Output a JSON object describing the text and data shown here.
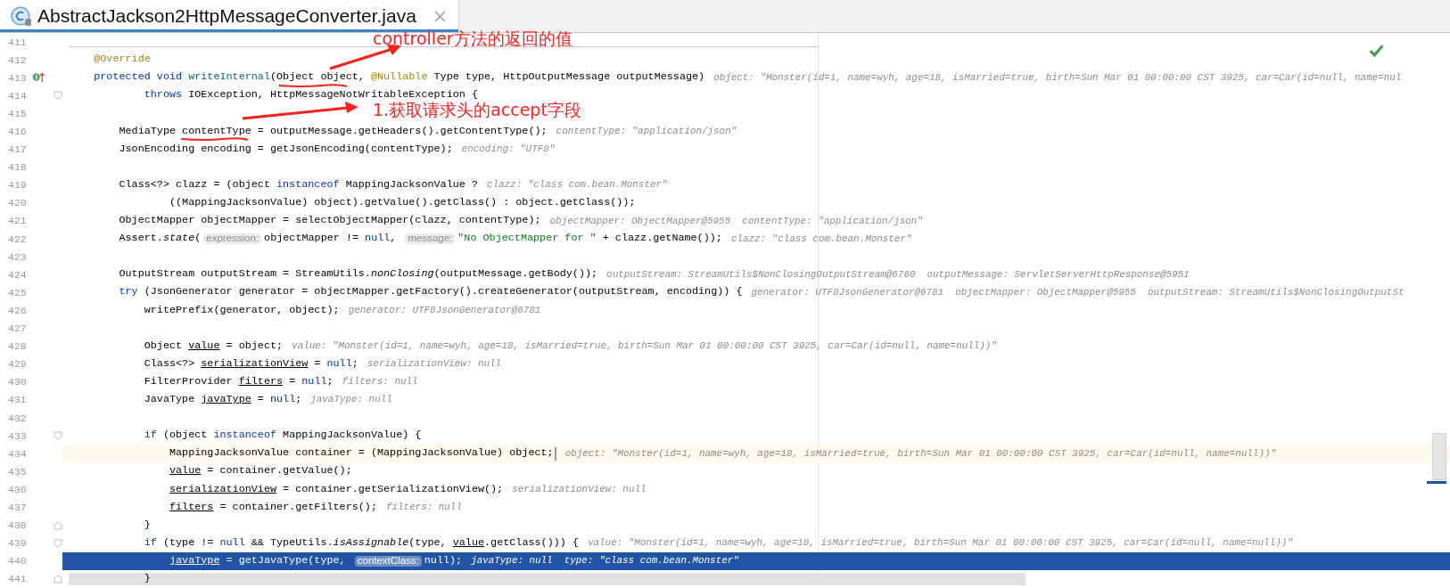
{
  "tab": {
    "title": "AbstractJackson2HttpMessageConverter.java",
    "selected": true
  },
  "lines": [
    {
      "number": "411"
    },
    {
      "number": "412",
      "code": [
        {
          "text": "    @Override",
          "kind": "annotation"
        }
      ]
    },
    {
      "number": "413",
      "implements": true,
      "code": [
        {
          "text": "    protected void ",
          "kind": "keyword"
        },
        {
          "text": "writeInternal",
          "kind": "method"
        },
        {
          "text": "(Object object, ",
          "kind": "plain"
        },
        {
          "text": "@Nullable",
          "kind": "annotation"
        },
        {
          "text": " Type type, HttpOutputMessage outputMessage)",
          "kind": "plain"
        }
      ],
      "hint": "object: \"Monster(id=1, name=wyh, age=18, isMarried=true, birth=Sun Mar 01 00:00:00 CST 3925, car=Car(id=null, name=nul"
    },
    {
      "number": "414",
      "fold_start": true,
      "code": [
        {
          "text": "            throws",
          "kind": "keyword"
        },
        {
          "text": " IOException, HttpMessageNotWritableException {",
          "kind": "plain"
        }
      ]
    },
    {
      "number": "415"
    },
    {
      "number": "416",
      "code": [
        {
          "text": "        MediaType contentType = outputMessage.getHeaders().getContentType();",
          "kind": "plain"
        }
      ],
      "hint": "contentType: \"application/json\""
    },
    {
      "number": "417",
      "code": [
        {
          "text": "        JsonEncoding encoding = getJsonEncoding(contentType);",
          "kind": "plain"
        }
      ],
      "hint": "encoding: \"UTF8\""
    },
    {
      "number": "418"
    },
    {
      "number": "419",
      "code": [
        {
          "text": "        Class<?> clazz = (object ",
          "kind": "plain"
        },
        {
          "text": "instanceof",
          "kind": "keyword"
        },
        {
          "text": " MappingJacksonValue ?",
          "kind": "plain"
        }
      ],
      "hint": "clazz: \"class com.bean.Monster\""
    },
    {
      "number": "420",
      "code": [
        {
          "text": "                ((MappingJacksonValue) object).getValue().getClass() : object.getClass());",
          "kind": "plain"
        }
      ]
    },
    {
      "number": "421",
      "code": [
        {
          "text": "        ObjectMapper objectMapper = selectObjectMapper(clazz, contentType);",
          "kind": "plain"
        }
      ],
      "hint": "objectMapper: ObjectMapper@5955  contentType: \"application/json\""
    },
    {
      "number": "422",
      "code": [
        {
          "text": "        Assert.",
          "kind": "plain"
        },
        {
          "text": "state",
          "kind": "static"
        },
        {
          "text": "(",
          "kind": "plain"
        },
        {
          "text": "expression:",
          "kind": "param_hint"
        },
        {
          "text": "objectMapper != ",
          "kind": "plain"
        },
        {
          "text": "null",
          "kind": "keyword"
        },
        {
          "text": ", ",
          "kind": "plain"
        },
        {
          "text": "message:",
          "kind": "param_hint"
        },
        {
          "text": "\"No ObjectMapper for \"",
          "kind": "string"
        },
        {
          "text": " + clazz.getName());",
          "kind": "plain"
        }
      ],
      "hint": "clazz: \"class com.bean.Monster\""
    },
    {
      "number": "423"
    },
    {
      "number": "424",
      "code": [
        {
          "text": "        OutputStream outputStream = StreamUtils.",
          "kind": "plain"
        },
        {
          "text": "nonClosing",
          "kind": "static"
        },
        {
          "text": "(outputMessage.getBody());",
          "kind": "plain"
        }
      ],
      "hint": "outputStream: StreamUtils$NonClosingOutputStream@6760  outputMessage: ServletServerHttpResponse@5951"
    },
    {
      "number": "425",
      "code": [
        {
          "text": "        try",
          "kind": "keyword"
        },
        {
          "text": " (JsonGenerator generator = objectMapper.getFactory().createGenerator(outputStream, encoding)) {",
          "kind": "plain"
        }
      ],
      "hint": "generator: UTF8JsonGenerator@6781  objectMapper: ObjectMapper@5955  outputStream: StreamUtils$NonClosingOutputSt"
    },
    {
      "number": "426",
      "code": [
        {
          "text": "            writePrefix(generator, object);",
          "kind": "plain"
        }
      ],
      "hint": "generator: UTF8JsonGenerator@6781"
    },
    {
      "number": "427"
    },
    {
      "number": "428",
      "code": [
        {
          "text": "            Object ",
          "kind": "plain"
        },
        {
          "text": "value",
          "kind": "reassigned"
        },
        {
          "text": " = object;",
          "kind": "plain"
        }
      ],
      "hint": "value: \"Monster(id=1, name=wyh, age=18, isMarried=true, birth=Sun Mar 01 00:00:00 CST 3925, car=Car(id=null, name=null))\""
    },
    {
      "number": "429",
      "code": [
        {
          "text": "            Class<?> ",
          "kind": "plain"
        },
        {
          "text": "serializationView",
          "kind": "reassigned"
        },
        {
          "text": " = ",
          "kind": "plain"
        },
        {
          "text": "null",
          "kind": "keyword"
        },
        {
          "text": ";",
          "kind": "plain"
        }
      ],
      "hint": "serializationView: null"
    },
    {
      "number": "430",
      "code": [
        {
          "text": "            FilterProvider ",
          "kind": "plain"
        },
        {
          "text": "filters",
          "kind": "reassigned"
        },
        {
          "text": " = ",
          "kind": "plain"
        },
        {
          "text": "null",
          "kind": "keyword"
        },
        {
          "text": ";",
          "kind": "plain"
        }
      ],
      "hint": "filters: null"
    },
    {
      "number": "431",
      "code": [
        {
          "text": "            JavaType ",
          "kind": "plain"
        },
        {
          "text": "javaType",
          "kind": "reassigned"
        },
        {
          "text": " = ",
          "kind": "plain"
        },
        {
          "text": "null",
          "kind": "keyword"
        },
        {
          "text": ";",
          "kind": "plain"
        }
      ],
      "hint": "javaType: null"
    },
    {
      "number": "432"
    },
    {
      "number": "433",
      "fold_start": true,
      "code": [
        {
          "text": "            if",
          "kind": "keyword"
        },
        {
          "text": " (object ",
          "kind": "plain"
        },
        {
          "text": "instanceof",
          "kind": "keyword"
        },
        {
          "text": " MappingJacksonValue) {",
          "kind": "plain"
        }
      ]
    },
    {
      "number": "434",
      "caret_line": true,
      "code": [
        {
          "text": "                MappingJacksonValue container = (MappingJacksonValue) object;",
          "kind": "plain"
        }
      ],
      "hint": "object: \"Monster(id=1, name=wyh, age=18, isMarried=true, birth=Sun Mar 01 00:00:00 CST 3925, car=Car(id=null, name=null))\""
    },
    {
      "number": "435",
      "code": [
        {
          "text": "                value",
          "kind": "reassigned"
        },
        {
          "text": " = container.getValue();",
          "kind": "plain"
        }
      ]
    },
    {
      "number": "436",
      "code": [
        {
          "text": "                serializationView",
          "kind": "reassigned"
        },
        {
          "text": " = container.getSerializationView();",
          "kind": "plain"
        }
      ],
      "hint": "serializationView: null"
    },
    {
      "number": "437",
      "code": [
        {
          "text": "                filters",
          "kind": "reassigned"
        },
        {
          "text": " = container.getFilters();",
          "kind": "plain"
        }
      ],
      "hint": "filters: null"
    },
    {
      "number": "438",
      "fold_end": true,
      "code": [
        {
          "text": "            }",
          "kind": "plain"
        }
      ]
    },
    {
      "number": "439",
      "fold_start": true,
      "code": [
        {
          "text": "            if",
          "kind": "keyword"
        },
        {
          "text": " (type != ",
          "kind": "plain"
        },
        {
          "text": "null",
          "kind": "keyword"
        },
        {
          "text": " && TypeUtils.",
          "kind": "plain"
        },
        {
          "text": "isAssignable",
          "kind": "static"
        },
        {
          "text": "(type, ",
          "kind": "plain"
        },
        {
          "text": "value",
          "kind": "reassigned"
        },
        {
          "text": ".getClass())) {",
          "kind": "plain"
        }
      ],
      "hint": "value: \"Monster(id=1, name=wyh, age=18, isMarried=true, birth=Sun Mar 01 00:00:00 CST 3925, car=Car(id=null, name=null))\""
    },
    {
      "number": "440",
      "execution_point": true,
      "code": [
        {
          "text": "                javaType",
          "kind": "reassigned"
        },
        {
          "text": " = getJavaType(type, ",
          "kind": "plain"
        },
        {
          "text": "contextClass:",
          "kind": "param_hint"
        },
        {
          "text": "null);",
          "kind": "plain"
        }
      ],
      "hint": "javaType: null  type: \"class com.bean.Monster\""
    },
    {
      "number": "441",
      "fold_end": true,
      "code": [
        {
          "text": "            }",
          "kind": "plain"
        }
      ]
    }
  ],
  "notes": [
    {
      "text": "controller方法的返回的值"
    },
    {
      "text": "1.获取请求头的accept字段"
    }
  ]
}
